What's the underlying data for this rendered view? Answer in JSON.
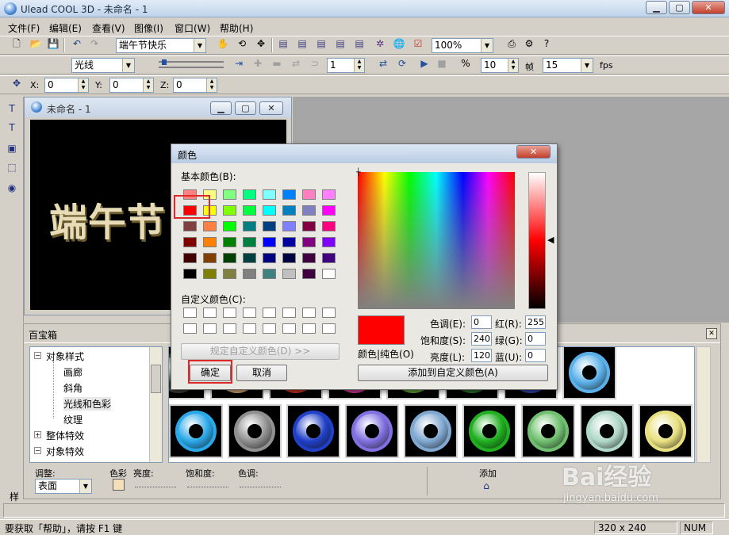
{
  "app": {
    "title": "Ulead COOL 3D - 未命名 - 1"
  },
  "window_buttons": {
    "minimize": "▁",
    "maximize": "▢",
    "close": "✕"
  },
  "menus": [
    "文件(F)",
    "编辑(E)",
    "查看(V)",
    "图像(I)",
    "窗口(W)",
    "帮助(H)"
  ],
  "toolbar1": {
    "text_combo": "端午节快乐",
    "zoom_combo": "100%"
  },
  "toolbar2": {
    "light_combo": "光线",
    "frame_value": "1",
    "fps_value_a": "10",
    "frame_label": "帧",
    "fps_value_b": "15",
    "fps_label": "fps"
  },
  "toolbar3": {
    "x_label": "X:",
    "x_value": "0",
    "y_label": "Y:",
    "y_value": "0",
    "z_label": "Z:",
    "z_value": "0"
  },
  "document": {
    "title": "未命名 - 1",
    "canvas_text": "端午节"
  },
  "baibao": {
    "title": "百宝箱",
    "tree": [
      {
        "label": "对象样式",
        "level": 0,
        "toggle": "−"
      },
      {
        "label": "画廊",
        "level": 1
      },
      {
        "label": "斜角",
        "level": 1
      },
      {
        "label": "光线和色彩",
        "level": 1
      },
      {
        "label": "纹理",
        "level": 1
      },
      {
        "label": "整体特效",
        "level": 0,
        "toggle": "+"
      },
      {
        "label": "对象特效",
        "level": 0,
        "toggle": "−"
      }
    ],
    "adjust": {
      "label": "调整:",
      "combo": "表面",
      "color_label": "色彩",
      "brightness_label": "亮度:",
      "saturation_label": "饱和度:",
      "hue_label": "色调:",
      "add_label": "添加"
    },
    "thumbs_row1_colors": [
      "#3a3a3a",
      "#c8a070",
      "#c83020",
      "#c03890",
      "#5a9a30",
      "#2a6a2a",
      "#3040a0",
      "#5ab0e8"
    ],
    "thumbs_row2_colors": [
      "#2aa8e8",
      "#909090",
      "#2040c8",
      "#8070e0",
      "#80a8d0",
      "#20b020",
      "#70c070",
      "#b0d8c8",
      "#e8e080"
    ]
  },
  "color_dialog": {
    "title": "颜色",
    "basic_colors_label": "基本颜色(B):",
    "custom_colors_label": "自定义颜色(C):",
    "define_custom_button": "规定自定义颜色(D) >>",
    "ok_button": "确定",
    "cancel_button": "取消",
    "add_custom_button": "添加到自定义颜色(A)",
    "solid_label": "颜色|纯色(O)",
    "hue_label": "色调(E):",
    "hue_value": "0",
    "sat_label": "饱和度(S):",
    "sat_value": "240",
    "lum_label": "亮度(L):",
    "lum_value": "120",
    "red_label": "红(R):",
    "red_value": "255",
    "green_label": "绿(G):",
    "green_value": "0",
    "blue_label": "蓝(U):",
    "blue_value": "0",
    "basic_colors": [
      "#ff8080",
      "#ffff80",
      "#80ff80",
      "#00ff80",
      "#80ffff",
      "#0080ff",
      "#ff80c0",
      "#ff80ff",
      "#ff0000",
      "#ffff00",
      "#80ff00",
      "#00ff40",
      "#00ffff",
      "#0080c0",
      "#8080c0",
      "#ff00ff",
      "#804040",
      "#ff8040",
      "#00ff00",
      "#008080",
      "#004080",
      "#8080ff",
      "#800040",
      "#ff0080",
      "#800000",
      "#ff8000",
      "#008000",
      "#008040",
      "#0000ff",
      "#0000a0",
      "#800080",
      "#8000ff",
      "#400000",
      "#804000",
      "#004000",
      "#004040",
      "#000080",
      "#000040",
      "#400040",
      "#400080",
      "#000000",
      "#808000",
      "#808040",
      "#808080",
      "#408080",
      "#c0c0c0",
      "#400040",
      "#ffffff"
    ]
  },
  "status": {
    "help_text": "要获取「帮助」，请按 F1 键",
    "size": "320 x 240",
    "num": "NUM",
    "bottom_tab": "样"
  },
  "watermark": {
    "brand": "Bai经验",
    "url": "jingyan.baidu.com"
  }
}
